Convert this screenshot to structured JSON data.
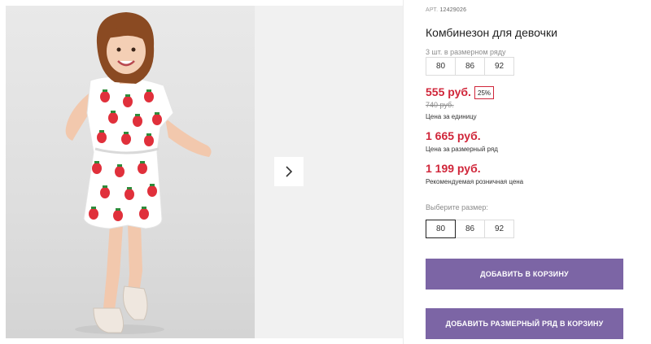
{
  "product": {
    "sku_label": "АРТ.",
    "sku": "12429026",
    "title": "Комбинезон для девочки"
  },
  "size_row": {
    "note": "3 шт. в размерном ряду",
    "sizes": [
      "80",
      "86",
      "92"
    ]
  },
  "prices": {
    "unit_price": "555 руб.",
    "discount": "25%",
    "old_price": "740 руб.",
    "unit_caption": "Цена за единицу",
    "row_price": "1 665 руб.",
    "row_caption": "Цена за размерный ряд",
    "rrp": "1 199 руб.",
    "rrp_caption": "Рекомендуемая розничная цена"
  },
  "size_picker": {
    "label": "Выберите размер:",
    "options": [
      "80",
      "86",
      "92"
    ],
    "selected": "80"
  },
  "actions": {
    "add_to_cart": "ДОБАВИТЬ В КОРЗИНУ",
    "add_row_to_cart": "ДОБАВИТЬ РАЗМЕРНЫЙ РЯД В КОРЗИНУ"
  },
  "gallery": {
    "next_icon": "chevron-right-icon",
    "photo_subject": "girl in strawberry-print romper"
  },
  "colors": {
    "price": "#d0263a",
    "button": "#7c65a5"
  }
}
